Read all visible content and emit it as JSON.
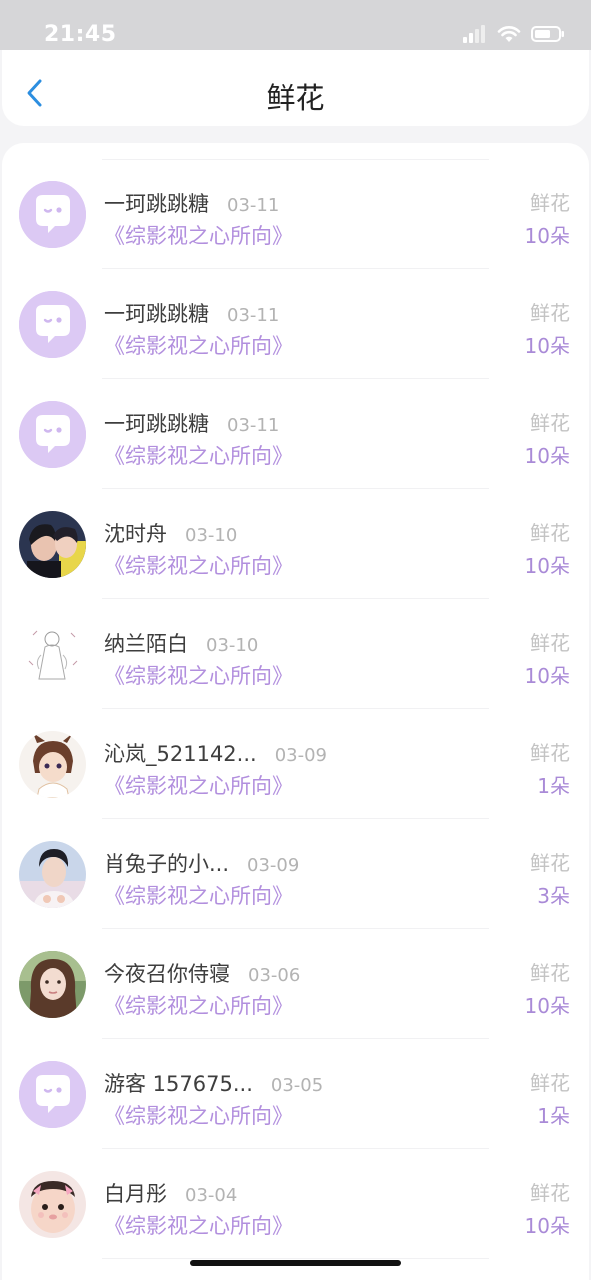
{
  "status_bar": {
    "time": "21:45"
  },
  "header": {
    "title": "鲜花"
  },
  "list": [
    {
      "name": "一珂跳跳糖",
      "date": "03-11",
      "book": "《综影视之心所向》",
      "gift_type": "鲜花",
      "count": "10朵",
      "avatar": "default-avatar"
    },
    {
      "name": "一珂跳跳糖",
      "date": "03-11",
      "book": "《综影视之心所向》",
      "gift_type": "鲜花",
      "count": "10朵",
      "avatar": "default-avatar"
    },
    {
      "name": "一珂跳跳糖",
      "date": "03-11",
      "book": "《综影视之心所向》",
      "gift_type": "鲜花",
      "count": "10朵",
      "avatar": "default-avatar"
    },
    {
      "name": "沈时舟",
      "date": "03-10",
      "book": "《综影视之心所向》",
      "gift_type": "鲜花",
      "count": "10朵",
      "avatar": "photo-couple"
    },
    {
      "name": "纳兰陌白",
      "date": "03-10",
      "book": "《综影视之心所向》",
      "gift_type": "鲜花",
      "count": "10朵",
      "avatar": "sketch-figure"
    },
    {
      "name": "沁岚_521142...",
      "date": "03-09",
      "book": "《综影视之心所向》",
      "gift_type": "鲜花",
      "count": "1朵",
      "avatar": "anime-character"
    },
    {
      "name": "肖兔子的小...",
      "date": "03-09",
      "book": "《综影视之心所向》",
      "gift_type": "鲜花",
      "count": "3朵",
      "avatar": "photo-man"
    },
    {
      "name": "今夜召你侍寝",
      "date": "03-06",
      "book": "《综影视之心所向》",
      "gift_type": "鲜花",
      "count": "10朵",
      "avatar": "photo-woman"
    },
    {
      "name": "游客 157675...",
      "date": "03-05",
      "book": "《综影视之心所向》",
      "gift_type": "鲜花",
      "count": "1朵",
      "avatar": "default-avatar"
    },
    {
      "name": "白月彤",
      "date": "03-04",
      "book": "《综影视之心所向》",
      "gift_type": "鲜花",
      "count": "10朵",
      "avatar": "photo-child"
    }
  ],
  "colors": {
    "accent": "#2c8ee0",
    "book_link": "#b28fde",
    "count": "#a98ad7",
    "default_avatar_bg": "#dcc9f4"
  }
}
